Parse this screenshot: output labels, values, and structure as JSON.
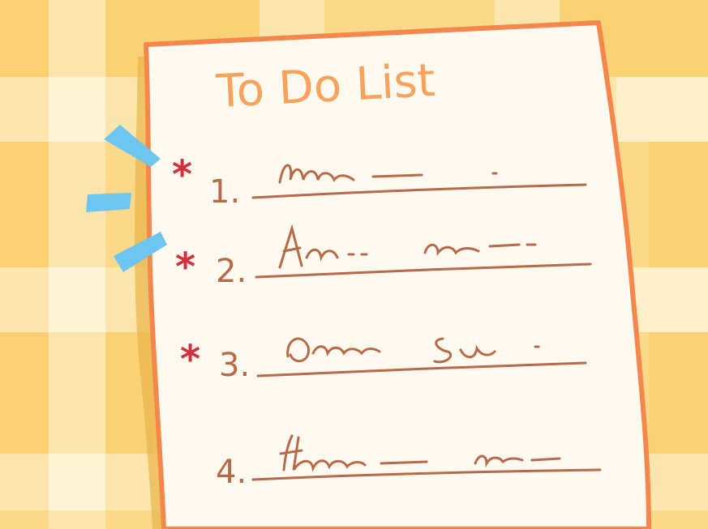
{
  "colors": {
    "background": "#fcd98a",
    "plaid_light": "#fde8b4",
    "plaid_pale": "#fff4d6",
    "plaid_dark": "#f8c95e",
    "paper": "#fffaf0",
    "paper_border": "#f5874c",
    "title": "#f7a35c",
    "ink": "#b76a4a",
    "star": "#d4303c",
    "accent_rays": "#6ec5ef"
  },
  "title": "To Do List",
  "items": [
    {
      "number": "1.",
      "starred": true
    },
    {
      "number": "2.",
      "starred": true
    },
    {
      "number": "3.",
      "starred": true
    },
    {
      "number": "4.",
      "starred": false
    }
  ],
  "icons": {
    "star": "asterisk-star-icon",
    "rays": "attention-rays-icon"
  }
}
